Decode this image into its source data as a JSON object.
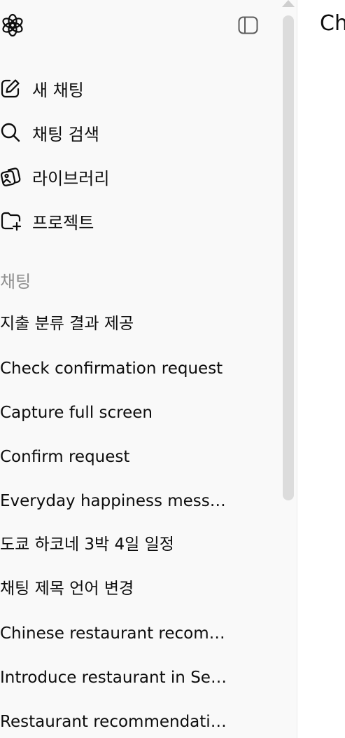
{
  "sidebar": {
    "nav": [
      {
        "label": "새 채팅",
        "icon": "compose-icon"
      },
      {
        "label": "채팅 검색",
        "icon": "search-icon"
      },
      {
        "label": "라이브러리",
        "icon": "library-icon"
      },
      {
        "label": "프로젝트",
        "icon": "new-project-folder-icon"
      }
    ],
    "section_label": "채팅",
    "chats": [
      "지출 분류 결과 제공",
      "Check confirmation request",
      "Capture full screen",
      "Confirm request",
      "Everyday happiness message",
      "도쿄 하코네 3박 4일 일정",
      "채팅 제목 언어 변경",
      "Chinese restaurant recomm...",
      "Introduce restaurant in Seo...",
      "Restaurant recommendatio..."
    ]
  },
  "main": {
    "title": "Ch"
  },
  "colors": {
    "sidebar_bg": "#f9f9f9",
    "muted_text": "#8f8f8f",
    "scrollbar": "#dcdcdc"
  }
}
